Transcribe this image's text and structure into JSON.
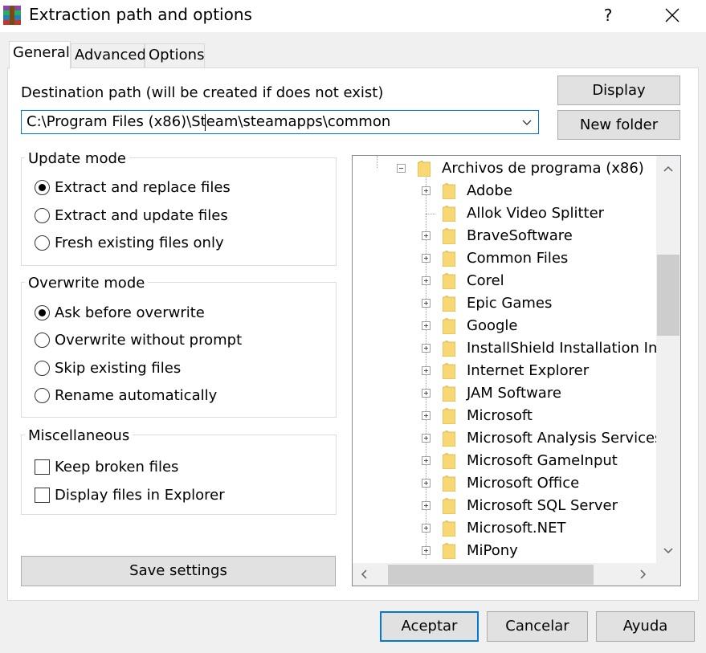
{
  "window": {
    "title": "Extraction path and options",
    "help_label": "?"
  },
  "tabs": [
    {
      "label": "General",
      "active": true
    },
    {
      "label": "Advanced",
      "active": false
    },
    {
      "label": "Options",
      "active": false
    }
  ],
  "destination": {
    "label": "Destination path (will be created if does not exist)",
    "value": "C:\\Program Files (x86)\\Steam\\steamapps\\common"
  },
  "buttons": {
    "display": "Display",
    "new_folder": "New folder",
    "save_settings": "Save settings",
    "accept": "Aceptar",
    "cancel": "Cancelar",
    "help": "Ayuda"
  },
  "update_mode": {
    "title": "Update mode",
    "options": [
      {
        "label": "Extract and replace files",
        "selected": true
      },
      {
        "label": "Extract and update files",
        "selected": false
      },
      {
        "label": "Fresh existing files only",
        "selected": false
      }
    ]
  },
  "overwrite_mode": {
    "title": "Overwrite mode",
    "options": [
      {
        "label": "Ask before overwrite",
        "selected": true
      },
      {
        "label": "Overwrite without prompt",
        "selected": false
      },
      {
        "label": "Skip existing files",
        "selected": false
      },
      {
        "label": "Rename automatically",
        "selected": false
      }
    ]
  },
  "misc": {
    "title": "Miscellaneous",
    "options": [
      {
        "label": "Keep broken files",
        "checked": false
      },
      {
        "label": "Display files in Explorer",
        "checked": false
      }
    ]
  },
  "tree": {
    "root": {
      "label": "Archivos de programa (x86)",
      "expanded": true
    },
    "children": [
      {
        "label": "Adobe",
        "expandable": true
      },
      {
        "label": "Allok Video Splitter",
        "expandable": false
      },
      {
        "label": "BraveSoftware",
        "expandable": true
      },
      {
        "label": "Common Files",
        "expandable": true
      },
      {
        "label": "Corel",
        "expandable": true
      },
      {
        "label": "Epic Games",
        "expandable": true
      },
      {
        "label": "Google",
        "expandable": true
      },
      {
        "label": "InstallShield Installation Info",
        "expandable": true
      },
      {
        "label": "Internet Explorer",
        "expandable": true
      },
      {
        "label": "JAM Software",
        "expandable": true
      },
      {
        "label": "Microsoft",
        "expandable": true
      },
      {
        "label": "Microsoft Analysis Services",
        "expandable": true
      },
      {
        "label": "Microsoft GameInput",
        "expandable": true
      },
      {
        "label": "Microsoft Office",
        "expandable": true
      },
      {
        "label": "Microsoft SQL Server",
        "expandable": true
      },
      {
        "label": "Microsoft.NET",
        "expandable": true
      },
      {
        "label": "MiPony",
        "expandable": true
      }
    ]
  },
  "colors": {
    "accent": "#0078d7",
    "folder": "#f8d775",
    "winrar_red": "#c0392b"
  }
}
